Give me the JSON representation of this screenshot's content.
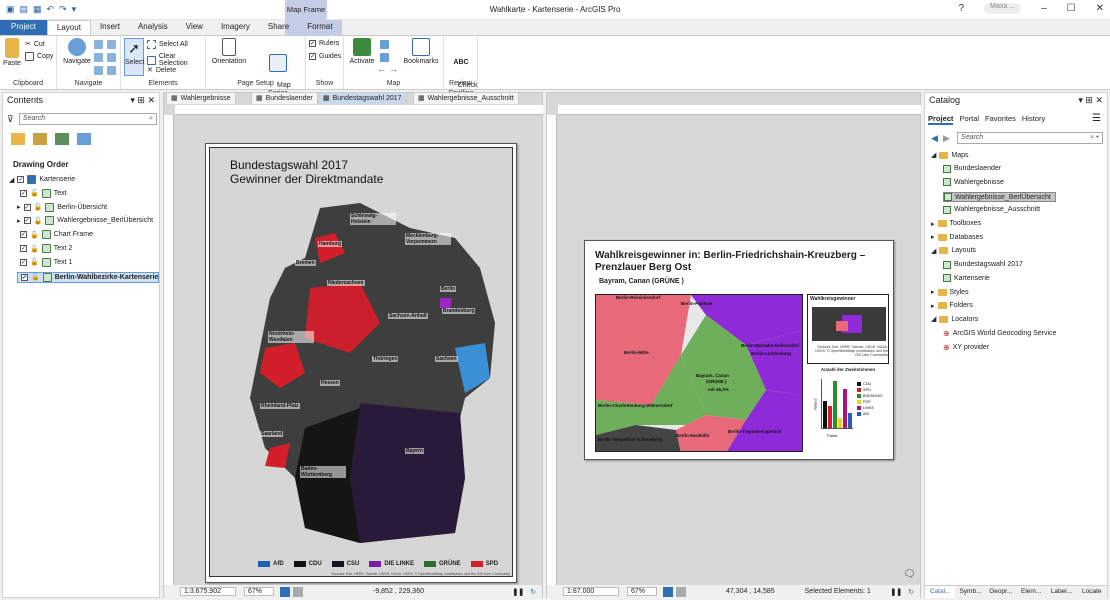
{
  "window": {
    "title": "Wahlkarte - Kartenserie - ArcGIS Pro",
    "user": "Maxa ...",
    "help": "?"
  },
  "ribbon_tabs": [
    "Project",
    "Layout",
    "Insert",
    "Analysis",
    "View",
    "Imagery",
    "Share",
    "Format"
  ],
  "contextual_tab_group": "Map Frame",
  "ribbon": {
    "clipboard": {
      "paste": "Paste",
      "cut": "Cut",
      "copy": "Copy",
      "label": "Clipboard"
    },
    "navigate": {
      "navigate": "Navigate",
      "label": "Navigate"
    },
    "elements": {
      "select": "Select",
      "select_all": "Select All",
      "clear_selection": "Clear Selection",
      "delete": "Delete",
      "label": "Elements"
    },
    "page_setup": {
      "orientation": "Orientation",
      "map_series": "Map\nSeries",
      "label": "Page Setup"
    },
    "show": {
      "rulers": "Rulers",
      "guides": "Guides",
      "label": "Show"
    },
    "map": {
      "activate": "Activate",
      "bookmarks": "Bookmarks",
      "label": "Map"
    },
    "review": {
      "check_spelling": "Check\nSpelling",
      "label": "Review"
    }
  },
  "contents": {
    "title": "Contents",
    "search_placeholder": "Search",
    "drawing_order": "Drawing Order",
    "items": [
      {
        "label": "Kartenserie",
        "level": 0
      },
      {
        "label": "Text",
        "level": 1
      },
      {
        "label": "Berlin-Übersicht",
        "level": 1
      },
      {
        "label": "Wahlergebnisse_BerlÜbersicht",
        "level": 1
      },
      {
        "label": "Chart Frame",
        "level": 1
      },
      {
        "label": "Text 2",
        "level": 1
      },
      {
        "label": "Text 1",
        "level": 1
      },
      {
        "label": "Berlin-Wahlbezirke-Kartenserie",
        "level": 1
      }
    ]
  },
  "view_tabs": [
    {
      "label": "Wahlergebnisse",
      "active": false
    },
    {
      "label": "Bundeslaender",
      "active": false
    },
    {
      "label": "Bundestagswahl 2017",
      "active": true
    },
    {
      "label": "Wahlergebnisse_Ausschnitt",
      "active": false
    },
    {
      "label": "Kartenserie",
      "active": true
    }
  ],
  "layout1": {
    "title_line1": "Bundestagswahl 2017",
    "title_line2": "Gewinner der Direktmandate",
    "places": [
      "Schleswig-Holstein",
      "Hamburg",
      "Mecklenburg-Vorpommern",
      "Bremen",
      "Niedersachsen",
      "Berlin",
      "Brandenburg",
      "Sachsen-Anhalt",
      "Nordrhein-Westfalen",
      "Sachsen",
      "Thüringen",
      "Hessen",
      "Rheinland-Pfalz",
      "Saarland",
      "Bayern",
      "Baden-Württemberg"
    ],
    "legend": [
      {
        "label": "AfD",
        "color": "#1f5fb4"
      },
      {
        "label": "CDU",
        "color": "#111111"
      },
      {
        "label": "CSU",
        "color": "#1c1226"
      },
      {
        "label": "DIE LINKE",
        "color": "#7b1fa2"
      },
      {
        "label": "GRÜNE",
        "color": "#2e6b2e"
      },
      {
        "label": "SPD",
        "color": "#d21f2b"
      }
    ],
    "credits": "Sources: Esri, HERE, Garmin, USGS, NOAA, USGS, © OpenStreetMap contributors, and the GIS User Community"
  },
  "layout2": {
    "title_line1": "Wahlkreisgewinner in: Berlin-Friedrichshain-Kreuzberg –",
    "title_line2": "Prenzlauer Berg Ost",
    "winner": "Bayram, Canan  (GRÜNE  )",
    "districts": [
      "Berlin-Pankow",
      "Berlin-Reinickendorf",
      "Berlin-Mitte",
      "Berlin-Marzahn-Hellersdorf",
      "Berlin-Lichtenberg",
      "Bayram, Canan",
      "(GRÜNE )",
      "mit 26,3%",
      "Berlin-Charlottenburg-Wilmersdorf",
      "Berlin-Tempelhof-Schöneberg",
      "Berlin-Neukölln",
      "Berlin-Treptow-Köpenick"
    ],
    "overview_title": "Wahlkreisgewinner",
    "overview_credits": "Sources: Esri, HERE, Garmin, USGS, NOAA, USGS, © OpenStreetMap contributors, and the GIS User Community",
    "chart_title": "Anzahl der Zweitstimmen",
    "chart_ylabel": "Values",
    "chart_xlabel": "Partei",
    "chart_legend": [
      {
        "label": "CDU",
        "color": "#111111"
      },
      {
        "label": "SPD",
        "color": "#d21f2b"
      },
      {
        "label": "BUENDNIS",
        "color": "#2e8b2e"
      },
      {
        "label": "FDP",
        "color": "#f2d21b"
      },
      {
        "label": "LINKE",
        "color": "#b0127a"
      },
      {
        "label": "AfD",
        "color": "#1f5fb4"
      }
    ],
    "chart_bars": [
      0.55,
      0.45,
      0.95,
      0.2,
      0.8,
      0.3
    ]
  },
  "status1": {
    "scale": "1:3.675.902",
    "zoom": "67%",
    "coords": "-9,852 , 229,360"
  },
  "status2": {
    "scale": "1:87.000",
    "zoom": "67%",
    "coords": "47,304 , 14,585",
    "selected": "Selected Elements: 1"
  },
  "catalog": {
    "title": "Catalog",
    "tabs": [
      "Project",
      "Portal",
      "Favorites",
      "History"
    ],
    "search_placeholder": "Search",
    "items": [
      {
        "label": "Maps",
        "level": 0,
        "kind": "folder"
      },
      {
        "label": "Bundeslaender",
        "level": 1,
        "kind": "map"
      },
      {
        "label": "Wahlergebnisse",
        "level": 1,
        "kind": "map"
      },
      {
        "label": "Wahlergebnisse_BerlÜbersicht",
        "level": 1,
        "kind": "map",
        "selected": true
      },
      {
        "label": "Wahlergebnisse_Ausschnitt",
        "level": 1,
        "kind": "map"
      },
      {
        "label": "Toolboxes",
        "level": 0,
        "kind": "folder"
      },
      {
        "label": "Databases",
        "level": 0,
        "kind": "folder"
      },
      {
        "label": "Layouts",
        "level": 0,
        "kind": "folder"
      },
      {
        "label": "Bundestagswahl 2017",
        "level": 1,
        "kind": "layout"
      },
      {
        "label": "Kartenserie",
        "level": 1,
        "kind": "layout"
      },
      {
        "label": "Styles",
        "level": 0,
        "kind": "folder"
      },
      {
        "label": "Folders",
        "level": 0,
        "kind": "folder"
      },
      {
        "label": "Locators",
        "level": 0,
        "kind": "folder"
      },
      {
        "label": "ArcGIS World Geocoding Service",
        "level": 1,
        "kind": "locator"
      },
      {
        "label": "XY provider",
        "level": 1,
        "kind": "locator"
      }
    ],
    "bottom_tabs": [
      "Catal...",
      "Symb...",
      "Geopr...",
      "Elem...",
      "Label...",
      "Locate"
    ]
  }
}
